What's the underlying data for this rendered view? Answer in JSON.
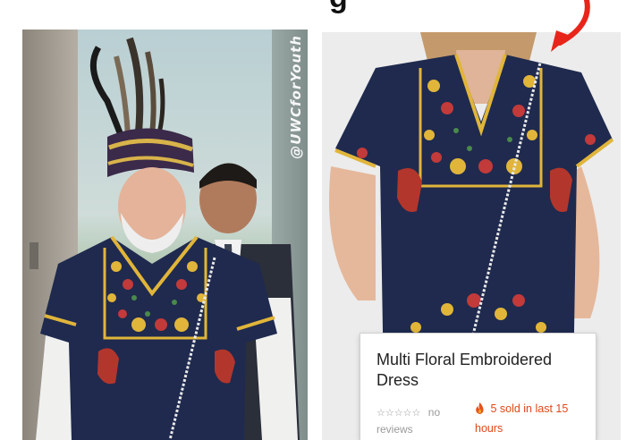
{
  "heading_fragment": "g",
  "left_photo": {
    "watermark": "@UWCforYouth"
  },
  "product": {
    "title": "Multi Floral Embroidered Dress",
    "rating_icon": "star-outline-icon",
    "stars": "☆☆☆☆☆",
    "reviews_word_1": "no",
    "reviews_word_2": "reviews",
    "sold_icon": "fire-icon",
    "sold_text": "5 sold in last 15 hours"
  },
  "colors": {
    "arrow": "#e8251b",
    "sold": "#e0481a",
    "garment_navy": "#1f2a4e",
    "embroidery_gold": "#e0b53a",
    "embroidery_red": "#c23a3a"
  }
}
